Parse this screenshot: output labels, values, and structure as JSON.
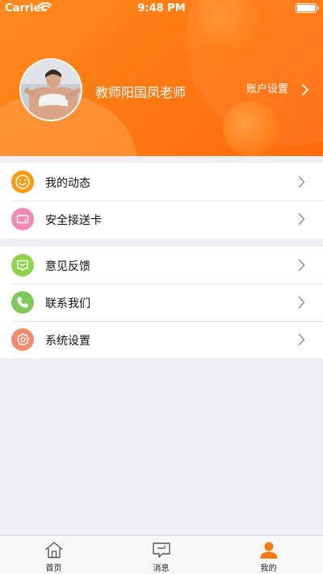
{
  "status_bar": {
    "carrier": "Carrier",
    "time": "9:48 PM"
  },
  "profile": {
    "name": "教师阳国凤老师",
    "account_settings_label": "账户设置"
  },
  "menu_group_1": [
    {
      "label": "我的动态",
      "icon": "smiley-icon",
      "color": "#ff9a0c"
    },
    {
      "label": "安全接送卡",
      "icon": "card-icon",
      "color": "#f58ab0"
    }
  ],
  "menu_group_2": [
    {
      "label": "意见反馈",
      "icon": "feedback-icon",
      "color": "#8ed34a"
    },
    {
      "label": "联系我们",
      "icon": "phone-icon",
      "color": "#7fc85a"
    },
    {
      "label": "系统设置",
      "icon": "settings-icon",
      "color": "#f28b6d"
    }
  ],
  "tabbar": {
    "tabs": [
      {
        "label": "首页",
        "icon": "home-icon"
      },
      {
        "label": "消息",
        "icon": "message-icon"
      },
      {
        "label": "我的",
        "icon": "person-icon",
        "active": true
      }
    ]
  },
  "colors": {
    "accent": "#ff7a12",
    "background": "#efeff4"
  }
}
